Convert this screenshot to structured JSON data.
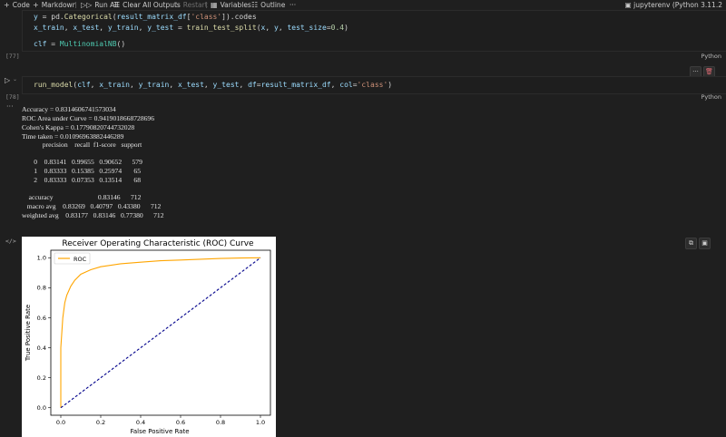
{
  "toolbar": {
    "code": "Code",
    "markdown": "Markdown",
    "run_all": "Run All",
    "clear_all_outputs": "Clear All Outputs",
    "restart": "Restart",
    "variables": "Variables",
    "outline": "Outline",
    "kernel": "jupyterenv (Python 3.11.2"
  },
  "cell1": {
    "exec_count": "[77]",
    "language": "Python",
    "lines": [
      "y = pd.Categorical(result_matrix_df['class']).codes",
      "x_train, x_test, y_train, y_test = train_test_split(x, y, test_size=0.4)",
      "",
      "clf = MultinomialNB()"
    ]
  },
  "cell2": {
    "exec_count": "[78]",
    "language": "Python",
    "code": "run_model(clf, x_train, y_train, x_test, y_test, df=result_matrix_df, col='class')"
  },
  "output": {
    "accuracy": "Accuracy = 0.8314606741573034",
    "roc_auc": "ROC Area under Curve = 0.9419018668728696",
    "kappa": "Cohen's Kappa = 0.17790820744732028",
    "time": "Time taken = 0.01096963882446289",
    "report_header": "            precision    recall  f1-score   support",
    "report_rows": [
      "       0    0.83141   0.99655   0.90652      579",
      "       1    0.83333   0.15385   0.25974       65",
      "       2    0.83333   0.07353   0.13514       68"
    ],
    "summary_rows": [
      "    accuracy                          0.83146      712",
      "   macro avg    0.83269   0.40797   0.43380      712",
      "weighted avg    0.83177   0.83146   0.77380      712"
    ]
  },
  "chart_data": {
    "type": "line",
    "title": "Receiver Operating Characteristic (ROC) Curve",
    "xlabel": "False Positive Rate",
    "ylabel": "True Positive Rate",
    "xlim": [
      -0.05,
      1.05
    ],
    "ylim": [
      -0.05,
      1.05
    ],
    "xticks": [
      "0.0",
      "0.2",
      "0.4",
      "0.6",
      "0.8",
      "1.0"
    ],
    "yticks": [
      "0.0",
      "0.2",
      "0.4",
      "0.6",
      "0.8",
      "1.0"
    ],
    "legend": "top-left",
    "series": [
      {
        "name": "ROC",
        "color": "#ffa500",
        "x": [
          0.0,
          0.0,
          0.01,
          0.02,
          0.03,
          0.05,
          0.07,
          0.1,
          0.15,
          0.2,
          0.3,
          0.4,
          0.5,
          0.6,
          0.7,
          0.8,
          0.9,
          1.0
        ],
        "y": [
          0.0,
          0.4,
          0.6,
          0.7,
          0.75,
          0.81,
          0.85,
          0.89,
          0.92,
          0.94,
          0.96,
          0.97,
          0.98,
          0.985,
          0.99,
          0.995,
          0.998,
          1.0
        ]
      },
      {
        "name": "",
        "color": "#00008b",
        "dashed": true,
        "x": [
          0.0,
          1.0
        ],
        "y": [
          0.0,
          1.0
        ]
      }
    ]
  }
}
